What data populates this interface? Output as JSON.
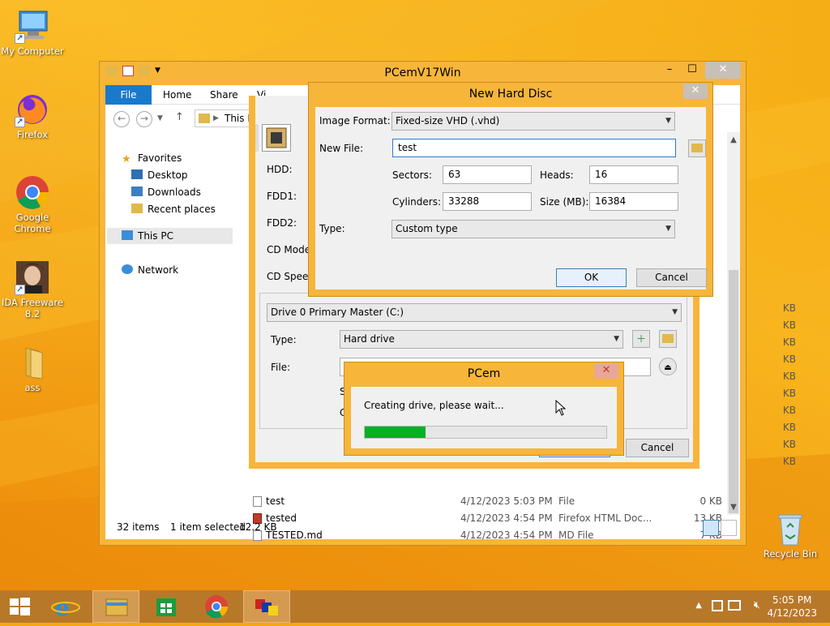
{
  "desktop": {
    "icons": [
      {
        "label": "My Computer"
      },
      {
        "label": "Firefox"
      },
      {
        "label": "Google Chrome"
      },
      {
        "label": "IDA Freeware 8.2"
      },
      {
        "label": "ass"
      },
      {
        "label": "Recycle Bin"
      }
    ]
  },
  "explorer": {
    "title": "PCemV17Win",
    "ribbon": {
      "file": "File",
      "home": "Home",
      "share": "Share",
      "view": "Vi"
    },
    "address": "This P",
    "nav": {
      "favorites": "Favorites",
      "desktop": "Desktop",
      "downloads": "Downloads",
      "recent": "Recent places",
      "thispc": "This PC",
      "network": "Network"
    },
    "files": [
      {
        "name": "test",
        "date": "4/12/2023 5:03 PM",
        "type": "File",
        "size": "0 KB"
      },
      {
        "name": "tested",
        "date": "4/12/2023 4:54 PM",
        "type": "Firefox HTML Doc...",
        "size": "13 KB"
      },
      {
        "name": "TESTED.md",
        "date": "4/12/2023 4:54 PM",
        "type": "MD File",
        "size": "7 KB"
      }
    ],
    "kb_label": "KB",
    "status": {
      "items": "32 items",
      "selected": "1 item selected",
      "size": "12.2 KB"
    }
  },
  "settings": {
    "hdd": "HDD:",
    "fdd1": "FDD1:",
    "fdd2": "FDD2:",
    "cd_mode": "CD Mode",
    "cd_speed": "CD Speed",
    "drive": "Drive 0 Primary Master (C:)",
    "type_label": "Type:",
    "type_value": "Hard drive",
    "file_label": "File:",
    "s_label": "S",
    "c_label": "C",
    "cancel": "Cancel"
  },
  "new_hard_disc": {
    "title": "New Hard Disc",
    "image_format_label": "Image Format:",
    "image_format_value": "Fixed-size VHD (.vhd)",
    "new_file_label": "New File:",
    "new_file_value": "test",
    "sectors_label": "Sectors:",
    "sectors_value": "63",
    "heads_label": "Heads:",
    "heads_value": "16",
    "cylinders_label": "Cylinders:",
    "cylinders_value": "33288",
    "size_label": "Size (MB):",
    "size_value": "16384",
    "type_label": "Type:",
    "type_value": "Custom type",
    "ok": "OK",
    "cancel": "Cancel"
  },
  "pcem_progress": {
    "title": "PCem",
    "message": "Creating drive, please wait...",
    "progress": 0.25,
    "progress_color": "#06b025"
  },
  "taskbar": {
    "time": "5:05 PM",
    "date": "4/12/2023"
  }
}
